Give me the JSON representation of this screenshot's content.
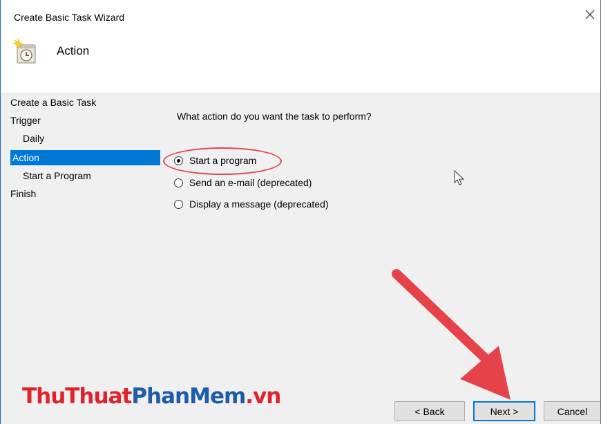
{
  "window": {
    "title": "Create Basic Task Wizard"
  },
  "header": {
    "title": "Action",
    "icon": "task-scheduler-icon"
  },
  "nav": {
    "items": [
      {
        "label": "Create a Basic Task"
      },
      {
        "label": "Trigger"
      },
      {
        "label": "Daily"
      },
      {
        "label": "Action"
      },
      {
        "label": "Start a Program"
      },
      {
        "label": "Finish"
      }
    ],
    "selected": "Action"
  },
  "content": {
    "question": "What action do you want the task to perform?",
    "options": [
      {
        "label": "Start a program",
        "checked": true
      },
      {
        "label": "Send an e-mail (deprecated)",
        "checked": false
      },
      {
        "label": "Display a message (deprecated)",
        "checked": false
      }
    ]
  },
  "buttons": {
    "back": "< Back",
    "next": "Next >",
    "cancel": "Cancel"
  },
  "watermark": {
    "part1": "ThuThuat",
    "part2": "PhanMem",
    "part3": ".vn"
  },
  "colors": {
    "selection": "#0078d7",
    "annotation": "#e2434b",
    "brand_red": "#e0232a",
    "brand_blue": "#1f5ba8"
  }
}
